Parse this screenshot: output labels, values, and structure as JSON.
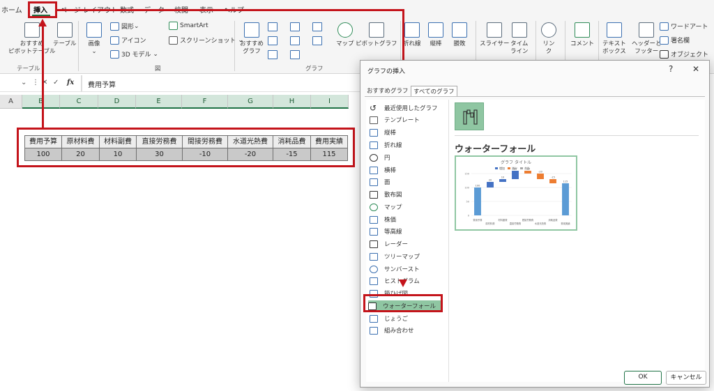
{
  "menu": [
    "ホーム",
    "挿入",
    "ページ レイアウト",
    "数式",
    "データ",
    "校閲",
    "表示",
    "ヘルプ"
  ],
  "ribbon": {
    "recommended_pivot_line1": "おすすめ",
    "recommended_pivot_line2": "ピボットテーブル",
    "table": "テーブル",
    "image": "画像",
    "shapes": "図形",
    "icons": "アイコン",
    "model3d": "3D モデル",
    "smartart": "SmartArt",
    "screenshot": "スクリーンショット",
    "recommended_chart_line1": "おすすめ",
    "recommended_chart_line2": "グラフ",
    "map": "マップ",
    "pivotchart": "ピボットグラフ",
    "sparkline_line": "折れ線",
    "sparkline_column": "縦棒",
    "sparkline_winloss": "勝敗",
    "slicer": "スライサー",
    "timeline_line1": "タイム",
    "timeline_line2": "ライン",
    "link_line1": "リン",
    "link_line2": "ク",
    "comment": "コメント",
    "textbox_line1": "テキスト",
    "textbox_line2": "ボックス",
    "headerfooter_line1": "ヘッダーと",
    "headerfooter_line2": "フッター",
    "wordart": "ワードアート",
    "signature": "署名欄",
    "object": "オブジェクト",
    "group_table": "テーブル",
    "group_figure": "図",
    "group_chart": "グラフ"
  },
  "formula_bar": {
    "fx": "fx",
    "content": "費用予算"
  },
  "columns": [
    "A",
    "B",
    "C",
    "D",
    "E",
    "F",
    "G",
    "H",
    "I"
  ],
  "sheet": {
    "headers": [
      "費用予算",
      "原材料費",
      "材料副費",
      "直接労務費",
      "間接労務費",
      "水道光熱費",
      "消耗品費",
      "費用実績"
    ],
    "values": [
      "100",
      "20",
      "10",
      "30",
      "-10",
      "-20",
      "-15",
      "115"
    ]
  },
  "dialog": {
    "title": "グラフの挿入",
    "help": "?",
    "close": "✕",
    "tab_recommended": "おすすめグラフ",
    "tab_all": "すべてのグラフ",
    "chart_types": [
      "最近使用したグラフ",
      "テンプレート",
      "縦棒",
      "折れ線",
      "円",
      "横棒",
      "面",
      "散布図",
      "マップ",
      "株価",
      "等高線",
      "レーダー",
      "ツリーマップ",
      "サンバースト",
      "ヒストグラム",
      "箱ひげ図",
      "ウォーターフォール",
      "じょうご",
      "組み合わせ"
    ],
    "selected_type": "ウォーターフォール",
    "preview_heading": "ウォーターフォール",
    "preview_chart_title": "グラフ タイトル",
    "preview_legend": [
      "増加",
      "減少",
      "合計"
    ],
    "ok": "OK",
    "cancel": "キャンセル"
  },
  "colors": {
    "accent": "#1e7145",
    "callout": "#c4141b",
    "increase": "#4472c4",
    "decrease": "#ed7d31",
    "total": "#5b9bd5"
  },
  "chart_data": {
    "type": "bar",
    "title": "グラフ タイトル",
    "categories": [
      "費用予算",
      "原材料費",
      "材料副費",
      "直接労務費",
      "間接労務費",
      "水道光熱費",
      "消耗品費",
      "費用実績"
    ],
    "values": [
      100,
      20,
      10,
      30,
      -10,
      -20,
      -15,
      115
    ],
    "legend": [
      "増加",
      "減少",
      "合計"
    ],
    "ylim": [
      0,
      150
    ]
  }
}
